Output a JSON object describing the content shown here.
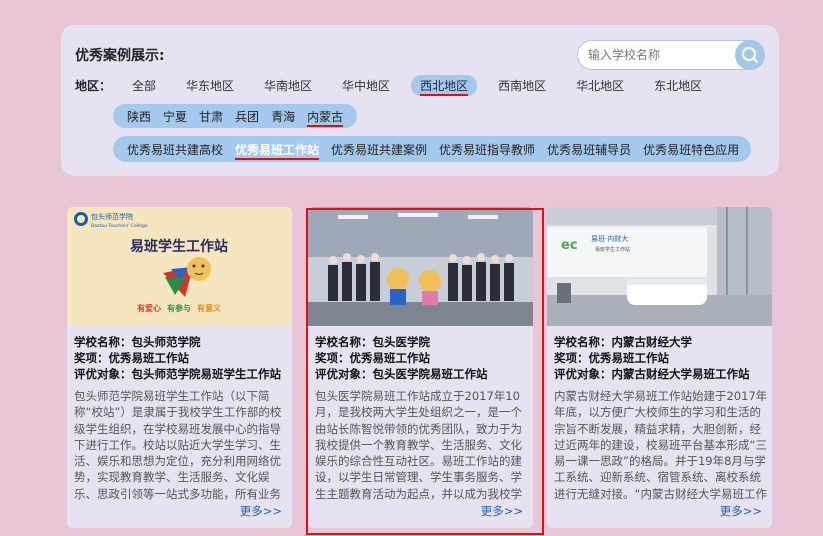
{
  "panel": {
    "title": "优秀案例展示:",
    "search": {
      "placeholder": "输入学校名称"
    },
    "region_label": "地区：",
    "regions": [
      "全部",
      "华东地区",
      "华南地区",
      "华中地区",
      "西北地区",
      "西南地区",
      "华北地区",
      "东北地区"
    ],
    "active_region": "西北地区",
    "provinces": [
      "陕西",
      "宁夏",
      "甘肃",
      "兵团",
      "青海",
      "内蒙古"
    ],
    "active_province": "内蒙古",
    "categories": [
      "优秀易班共建高校",
      "优秀易班工作站",
      "优秀易班共建案例",
      "优秀易班指导教师",
      "优秀易班辅导员",
      "优秀易班特色应用"
    ],
    "active_category": "优秀易班工作站"
  },
  "cards": [
    {
      "school": "学校名称：包头师范学院",
      "award": "奖项：优秀易班工作站",
      "target": "评优对象：包头师范学院易班学生工作站",
      "desc": "包头师范学院易班学生工作站（以下简称“校站”）是隶属于我校学生工作部的校级学生组织，在学校易班发展中心的指导下进行工作。校站以贴近大学生学习、生活、娱乐和思想为定位，充分利用网络优势，实现教育教学、生活服务、文化娱乐、思政引领等一站式多功能，所有业务都为广大师生服务。",
      "more": "更多>>",
      "logo_text": "包头师范学院",
      "logo_sub": "Baotou Teachers' College",
      "banner": "易班学生工作站",
      "slogan": [
        "有爱心",
        "有参与",
        "有意义"
      ]
    },
    {
      "school": "学校名称：包头医学院",
      "award": "奖项：优秀易班工作站",
      "target": "评优对象：包头医学院易班工作站",
      "desc": "包头医学院易班工作站成立于2017年10月，是我校两大学生处组织之一，是一个由站长陈智悦带领的优秀团队，致力于为我校提供一个教育教学、生活服务、文化娱乐的综合性互动社区。易班工作站的建设，以学生日常管理、学生事务服务、学生主题教育活动为起点，并以成为我校学生获取知识、交流学习的网络平台为目标。",
      "more": "更多>>"
    },
    {
      "school": "学校名称：内蒙古财经大学",
      "award": "奖项：优秀易班工作站",
      "target": "评优对象：内蒙古财经大学易班工作站",
      "desc": "内蒙古财经大学易班工作站始建于2017年年底，以方便广大校师生的学习和生活的宗旨不断发展，精益求精，大胆创新，经过近两年的建设，校易班平台基本形成“三易一课一思政”的格局。并于19年8月与学工系统、迎新系统、宿管系统、离校系统进行无缝对接。“内蒙古财经大学易班工作站”是学生获取信息的重要途径。",
      "more": "更多>>",
      "wall_text": "易班·内财大",
      "wall_sub": "易班学生工作站"
    }
  ],
  "colors": {
    "background": "#e8c6d8",
    "panel": "#e6e2f2",
    "pill": "#a4c8ee",
    "active_underline": "#dd1111",
    "link": "#2a5db0"
  }
}
